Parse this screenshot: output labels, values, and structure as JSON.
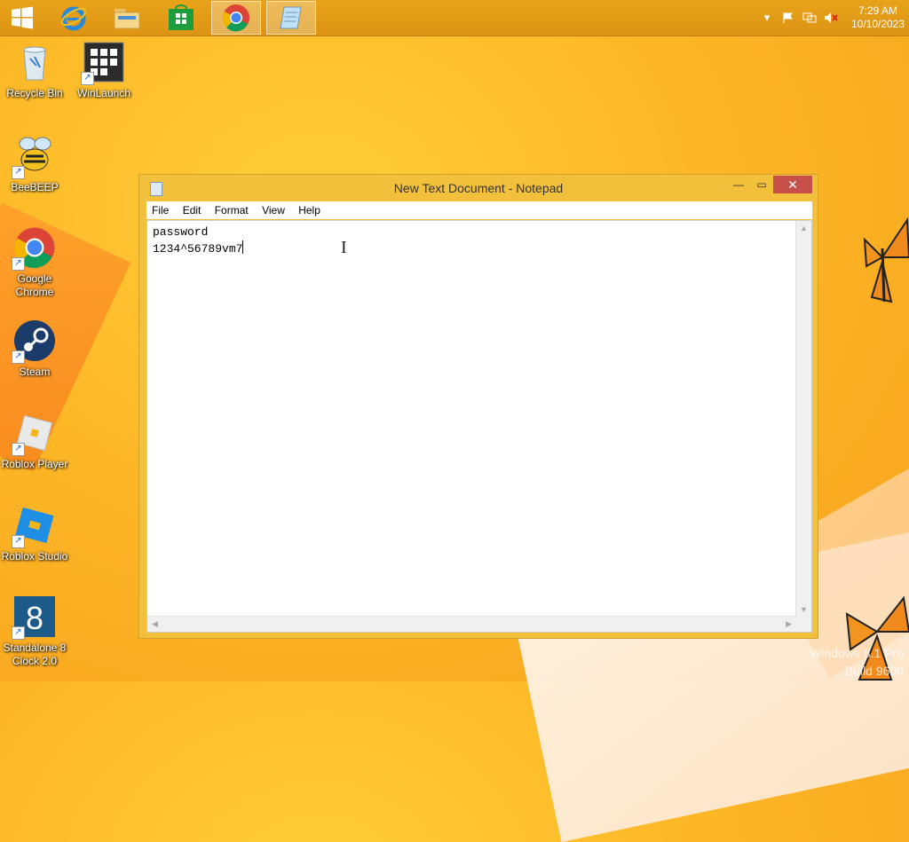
{
  "taskbar": {
    "apps": [
      {
        "name": "start",
        "label": "Start"
      },
      {
        "name": "internet-explorer",
        "label": "Internet Explorer"
      },
      {
        "name": "file-explorer",
        "label": "File Explorer"
      },
      {
        "name": "store",
        "label": "Store"
      },
      {
        "name": "chrome",
        "label": "Google Chrome"
      },
      {
        "name": "notepad",
        "label": "Notepad"
      }
    ],
    "clock_time": "7:29 AM",
    "clock_date": "10/10/2023"
  },
  "desktop": {
    "icons": [
      {
        "label": "Recycle Bin"
      },
      {
        "label": "WinLaunch"
      },
      {
        "label": "BeeBEEP"
      },
      {
        "label": "Google Chrome"
      },
      {
        "label": "Steam"
      },
      {
        "label": "Roblox Player"
      },
      {
        "label": "Roblox Studio"
      },
      {
        "label": "Standalone 8 Clock 2.0"
      }
    ]
  },
  "notepad": {
    "title": "New Text Document - Notepad",
    "menu": [
      "File",
      "Edit",
      "Format",
      "View",
      "Help"
    ],
    "lines": [
      "password",
      "1234^56789vm7"
    ]
  },
  "watermark": {
    "line1": "Windows 8.1 Pro",
    "line2": "Build 9600"
  },
  "colors": {
    "desktop": "#fdb726",
    "close_button": "#c7504a"
  }
}
